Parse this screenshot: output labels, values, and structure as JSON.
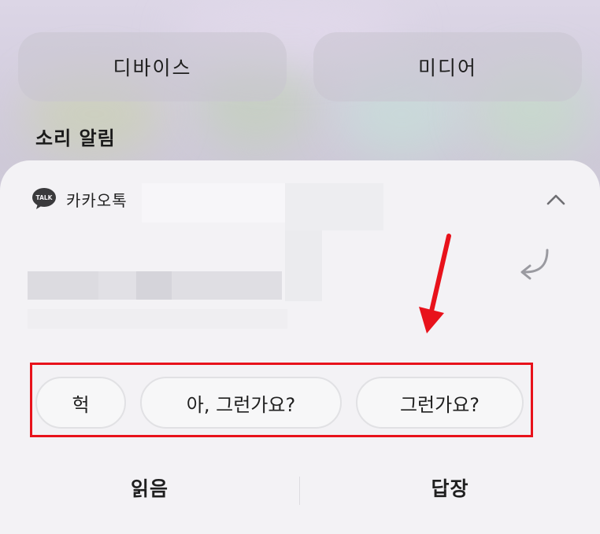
{
  "quick_settings": {
    "device_label": "디바이스",
    "media_label": "미디어"
  },
  "section": {
    "title": "소리 알림"
  },
  "notification": {
    "app_name": "카카오톡",
    "app_icon_text": "TALK",
    "expand_icon": "chevron-up-icon",
    "reply_icon": "reply-arrow-icon",
    "smart_replies": [
      "헉",
      "아, 그런가요?",
      "그런가요?"
    ],
    "actions": {
      "read_label": "읽음",
      "reply_label": "답장"
    }
  },
  "annotation": {
    "highlight_color": "#e8121b",
    "arrow_icon": "red-arrow-icon"
  }
}
